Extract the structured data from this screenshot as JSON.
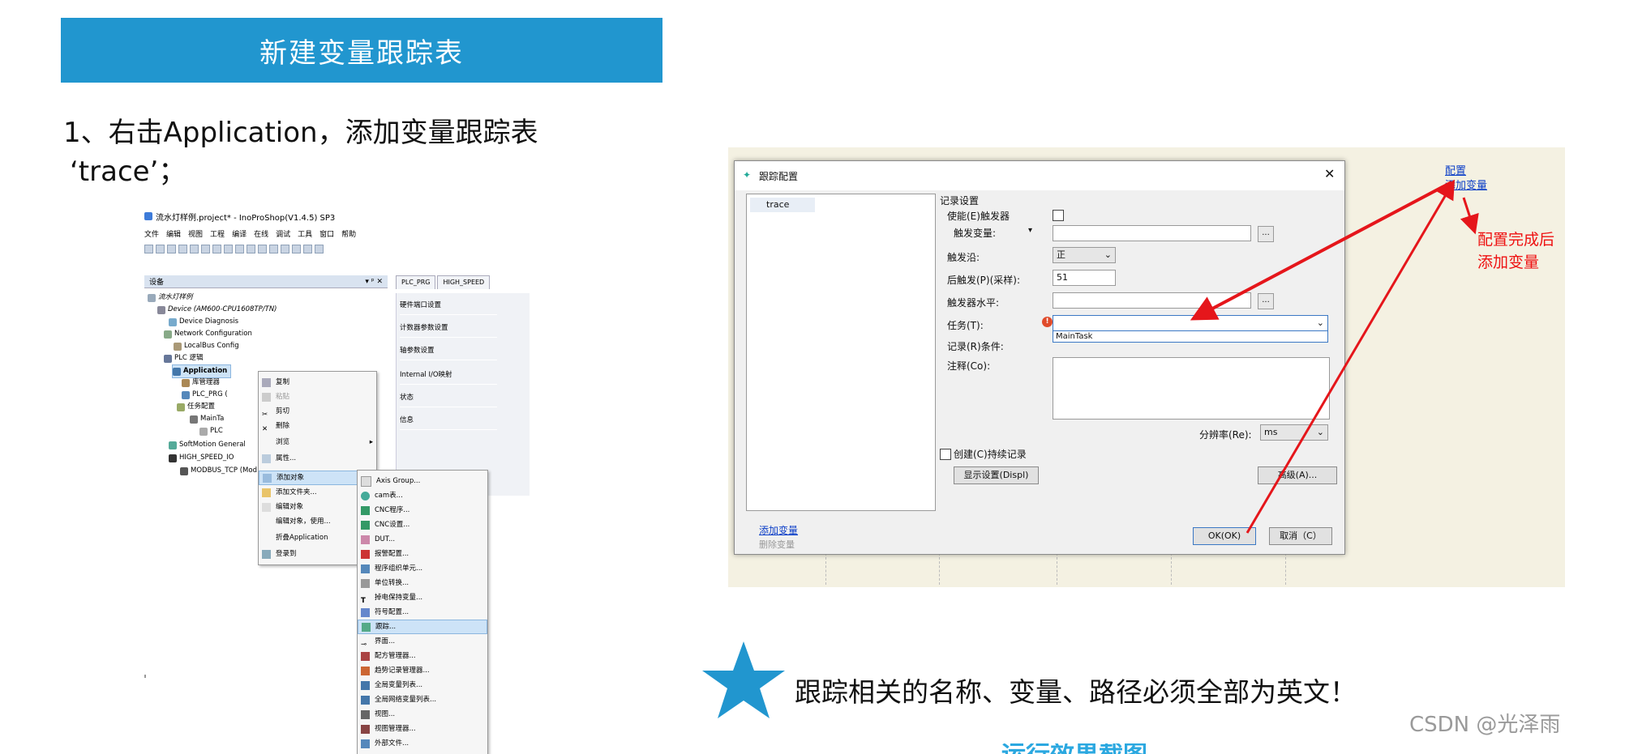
{
  "banner": {
    "title": "新建变量跟踪表"
  },
  "step": {
    "line1": "1、右击Application，添加变量跟踪表",
    "line2": "‘trace’；"
  },
  "ide": {
    "window_title": "流水灯样例.project* - InoProShop(V1.4.5) SP3",
    "menu": [
      "文件",
      "编辑",
      "视图",
      "工程",
      "编译",
      "在线",
      "调试",
      "工具",
      "窗口",
      "帮助"
    ],
    "panel_title": "设备",
    "tabs": [
      "PLC_PRG",
      "HIGH_SPEED"
    ],
    "tree": [
      "流水灯样例",
      "Device (AM600-CPU1608TP/TN)",
      "Device Diagnosis",
      "Network Configuration",
      "LocalBus Config",
      "PLC 逻辑",
      "Application",
      "库管理器",
      "PLC_PRG (",
      "任务配置",
      "MainTa",
      "PLC",
      "SoftMotion General",
      "HIGH_SPEED_IO",
      "MODBUS_TCP (Mod"
    ],
    "config_items": [
      "硬件端口设置",
      "计数器参数设置",
      "轴参数设置",
      "Internal I/O映射",
      "状态",
      "信息"
    ],
    "context_menu": [
      "复制",
      "粘贴",
      "剪切",
      "删除",
      "浏览",
      "属性...",
      "添加对象",
      "添加文件夹...",
      "编辑对象",
      "编辑对象，使用...",
      "折叠Application",
      "登录到"
    ],
    "submenu": [
      "Axis Group...",
      "cam表...",
      "CNC程序...",
      "CNC设置...",
      "DUT...",
      "报警配置...",
      "程序组织单元...",
      "单位转换...",
      "掉电保持变量...",
      "符号配置...",
      "跟踪...",
      "界面...",
      "配方管理器...",
      "趋势记录管理器...",
      "全局变量列表...",
      "全局网络变量列表...",
      "视图...",
      "视图管理器...",
      "外部文件..."
    ]
  },
  "dialog": {
    "title": "跟踪配置",
    "list_item": "trace",
    "section": "记录设置",
    "enable_trigger": "使能(E)触发器",
    "trigger_var": "触发变量:",
    "trigger_edge": "触发沿:",
    "trigger_edge_value": "正",
    "post_trigger": "后触发(P)(采样):",
    "post_trigger_value": "51",
    "trigger_level": "触发器水平:",
    "task": "任务(T):",
    "task_option": "MainTask",
    "record_condition": "记录(R)条件:",
    "comment": "注释(Co):",
    "resolution": "分辨率(Re):",
    "resolution_value": "ms",
    "persistent": "创建(C)持续记录",
    "display_settings": "显示设置(Displ)",
    "advanced": "高级(A)...",
    "add_variable": "添加变量",
    "delete_variable": "删除变量",
    "ok": "OK(OK)",
    "cancel": "取消（C）",
    "dots": "..."
  },
  "side_links": [
    "配置",
    "添加变量"
  ],
  "annotation": "配置完成后添加变量",
  "note": "跟踪相关的名称、变量、路径必须全部为英文！",
  "watermark": "CSDN @光泽雨",
  "cut_text": "运行效果截图",
  "colors": {
    "banner": "#2196cf",
    "star": "#2196cf",
    "arrow": "#e5161b",
    "link": "#0b3ec7"
  }
}
